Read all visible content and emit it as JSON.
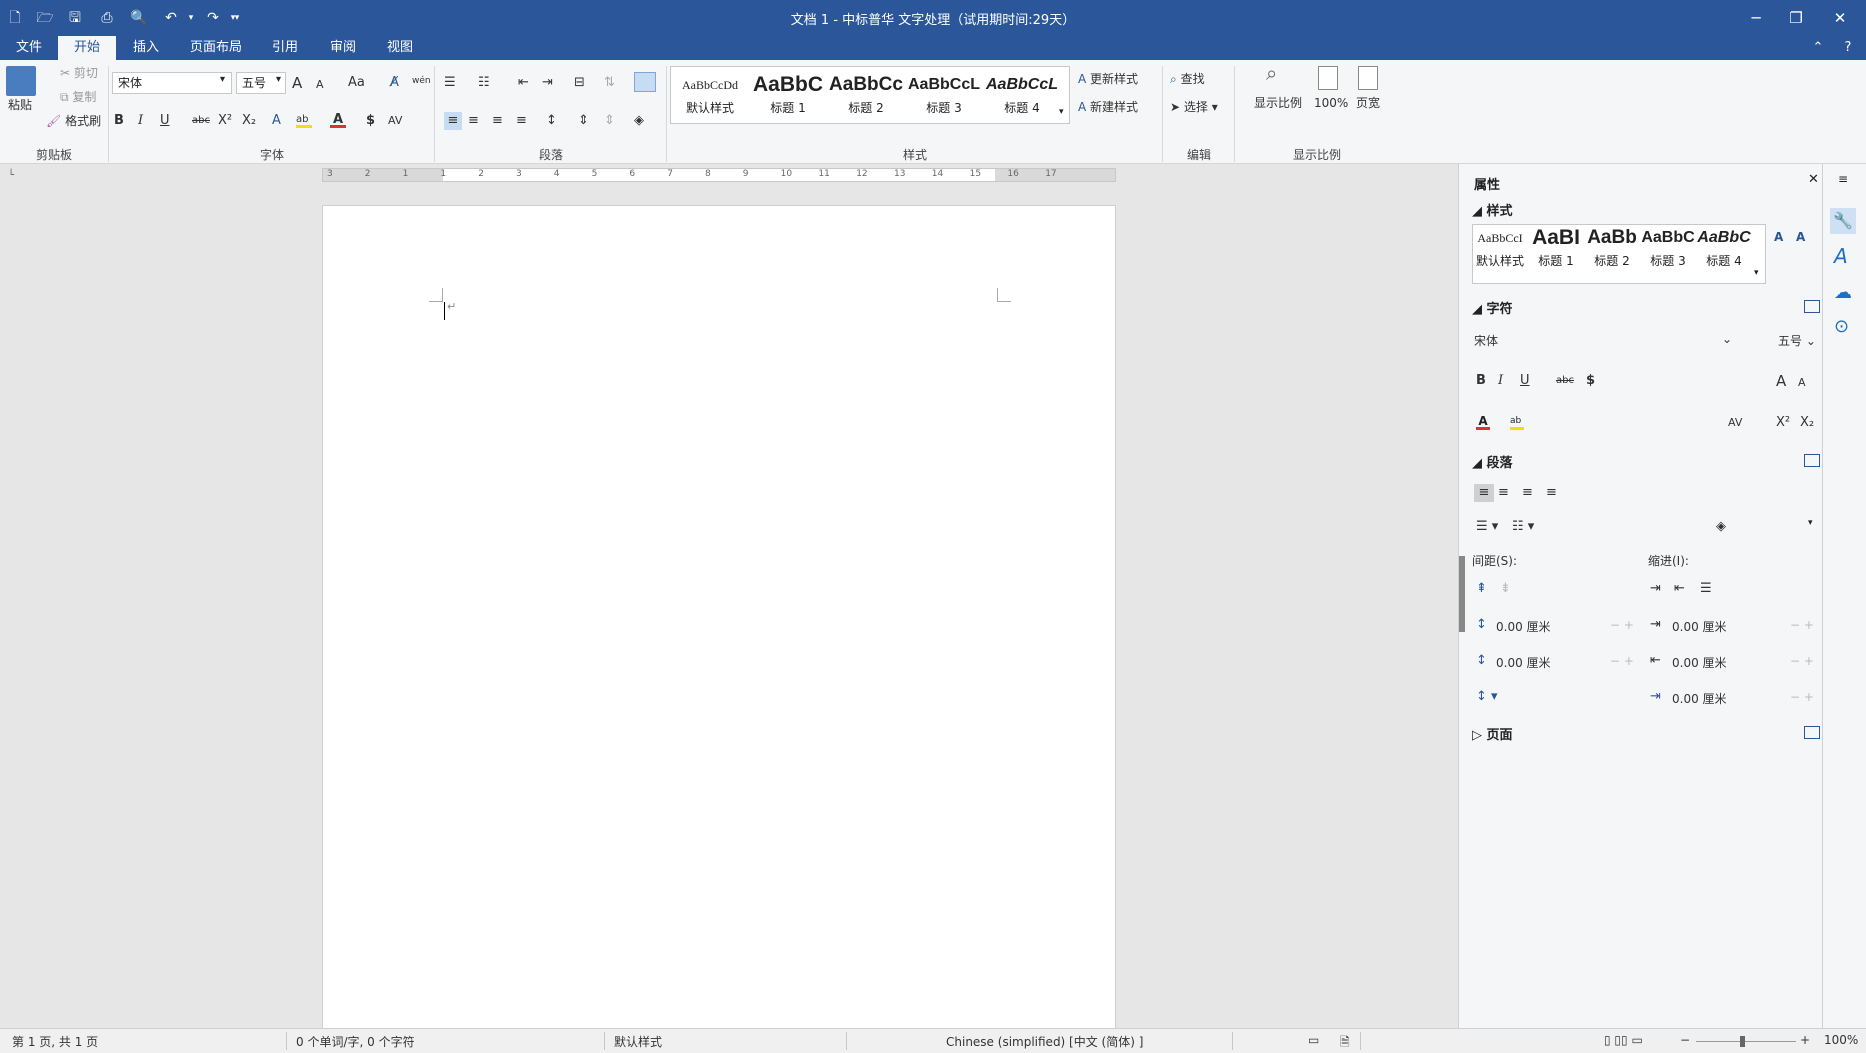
{
  "window": {
    "title": "文档 1 - 中标普华 文字处理（试用期时间:29天）"
  },
  "tabs": [
    "文件",
    "开始",
    "插入",
    "页面布局",
    "引用",
    "审阅",
    "视图"
  ],
  "clipboard": {
    "paste": "粘贴",
    "cut": "剪切",
    "copy": "复制",
    "format_painter": "格式刷",
    "group": "剪贴板"
  },
  "font": {
    "name": "宋体",
    "size": "五号",
    "group": "字体",
    "bold": "B",
    "italic": "I",
    "underline": "U",
    "strike": "abc",
    "sup": "X²",
    "sub": "X₂",
    "case": "Aa",
    "phonetic": "wén",
    "grow": "A",
    "shrink": "A",
    "color": "A",
    "char_spacing": "AV",
    "dollar": "$"
  },
  "paragraph": {
    "group": "段落"
  },
  "styles": {
    "group": "样式",
    "items": [
      {
        "preview": "AaBbCcDd",
        "name": "默认样式"
      },
      {
        "preview": "AaBbC",
        "name": "标题 1"
      },
      {
        "preview": "AaBbCc",
        "name": "标题 2"
      },
      {
        "preview": "AaBbCcL",
        "name": "标题 3"
      },
      {
        "preview": "AaBbCcL",
        "name": "标题 4"
      }
    ],
    "update": "更新样式",
    "new": "新建样式"
  },
  "edit": {
    "group": "编辑",
    "find": "查找",
    "select": "选择"
  },
  "zoom": {
    "group": "显示比例",
    "zoom": "显示比例",
    "pct": "100%",
    "width": "页宽"
  },
  "ruler": {
    "ticks": [
      "3",
      "2",
      "1",
      "1",
      "2",
      "3",
      "4",
      "5",
      "6",
      "7",
      "8",
      "9",
      "10",
      "11",
      "12",
      "13",
      "14",
      "15",
      "16",
      "17"
    ]
  },
  "panel": {
    "title": "属性",
    "styles_header": "样式",
    "styles": [
      {
        "preview": "AaBbCcI",
        "name": "默认样式"
      },
      {
        "preview": "AaBI",
        "name": "标题 1"
      },
      {
        "preview": "AaBb",
        "name": "标题 2"
      },
      {
        "preview": "AaBbC",
        "name": "标题 3"
      },
      {
        "preview": "AaBbC",
        "name": "标题 4"
      }
    ],
    "char_header": "字符",
    "font": "宋体",
    "size": "五号",
    "para_header": "段落",
    "spacing_label": "间距(S):",
    "indent_label": "缩进(I):",
    "before": "0.00 厘米",
    "after": "0.00 厘米",
    "indent_left": "0.00 厘米",
    "indent_right": "0.00 厘米",
    "indent_first": "0.00 厘米",
    "page_header": "页面"
  },
  "status": {
    "page": "第 1 页, 共 1 页",
    "words": "0 个单词/字, 0 个字符",
    "style": "默认样式",
    "lang": "Chinese (simplified) [中文 (简体) ]",
    "zoom": "100%"
  },
  "colors": {
    "accent": "#2b579a",
    "font_color": "#e03030",
    "highlight": "#f0e000",
    "panel_icon": "#1e6fc8"
  }
}
